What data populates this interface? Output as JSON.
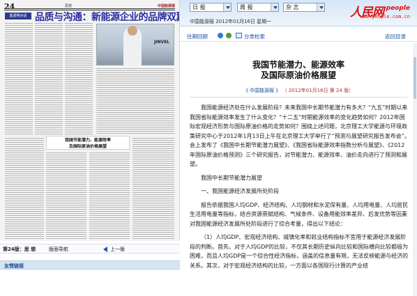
{
  "paper": {
    "page_number": "24",
    "section": "思想",
    "masthead": "中国能源报",
    "kicker": "能源明对话",
    "big_title": "品质与沟通：新能源企业的品牌双翼",
    "photo_logo": "JINVEL",
    "inner_headline": "我国节能潜力、能源效率\n及国际原油价格展望"
  },
  "page_nav": {
    "page_label": "第24版：思 想",
    "nav_label": "版面导航",
    "prev_label": "上一版"
  },
  "friendly_links": "友情链接",
  "topbar": {
    "selects": [
      {
        "value": "日 报"
      },
      {
        "value": "周 报"
      },
      {
        "value": "杂 志"
      }
    ],
    "logo_text": "人民网",
    "logo_word": "people",
    "logo_url": "www.people.com.cn",
    "dateline": "中国能源报  2012年01月16日 星期一"
  },
  "toolbar": {
    "back": "往期回顾",
    "catalog": "分类检索",
    "back_directory": "返回目录"
  },
  "article": {
    "title_line1": "我国节能潜力、能源效率",
    "title_line2": "及国际原油价格展望",
    "meta_source": "《 中国能源报 》",
    "meta_date": "（ 2012年01月16日   第 24 版）",
    "paragraphs": [
      "我国能源经济处在什么发展阶段？未来我国中长期节能潜力有多大？“九五”时期以来我国省际能源效率发生了什么变化？“十二五”时期能源效率的变化趋势如何？2012年国际宏观经济形势与国际原油价格的走势如何？围绕上述问题，北京理工大学能源与环境政策研究中心于2012年1月13日上午在北京理工大学举行了“预测与展望研究报告发布会”。会上发布了《我国中长期节能潜力展望》、《我国省际能源效率指数分析与展望》、《2012年国际原油价格预测》三个研究报告，对节能潜力、能源效率、油价走向进行了预测和展望。",
      "我国中长期节能潜力展望",
      "一、我国能源经济发展所处阶段",
      "报告依据我国人均GDP、经济结构、人均钢材和水泥保有量、人均用电量、人均居民生活用电量等指标，结合资源禀赋结构、气候条件、设备用能效率差异、后发优势等因素对我国能源经济发展所处阶段进行了综合考量，得出以下结论：",
      "（1）人均GDP、宏观经济结构、城镇化率和就业结构指标不宜用于能源经济发展阶段的判断。首先，对于人均GDP的比较，不仅其长期历史纵向比较和国际横向比较都极为困难，而且人均GDP是一个综合性经济指标，涵盖的信息量有限，无法反映能源与经济的关系。其次，对于宏观经济结构的比较，一方面以各国现行计算的产业结"
    ]
  }
}
